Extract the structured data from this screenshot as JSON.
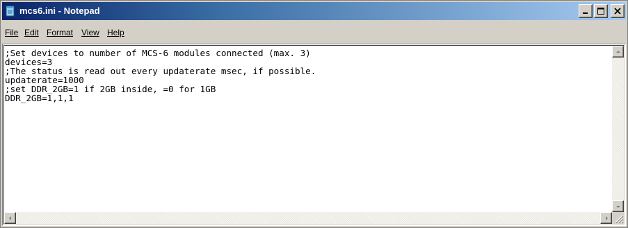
{
  "window": {
    "title": "mcs6.ini - Notepad",
    "icon": "notepad-icon",
    "controls": [
      "minimize-icon",
      "maximize-icon",
      "close-icon"
    ]
  },
  "menubar": {
    "items": [
      {
        "label": "File"
      },
      {
        "label": "Edit"
      },
      {
        "label": "Format"
      },
      {
        "label": "View"
      },
      {
        "label": "Help"
      }
    ]
  },
  "document": {
    "text": ";Set devices to number of MCS-6 modules connected (max. 3)\ndevices=3\n;The status is read out every updaterate msec, if possible.\nupdaterate=1000\n;set DDR_2GB=1 if 2GB inside, =0 for 1GB\nDDR_2GB=1,1,1"
  },
  "colors": {
    "title_gradient_start": "#0a246a",
    "title_gradient_end": "#a6caf0",
    "chrome": "#d4d0c8"
  }
}
